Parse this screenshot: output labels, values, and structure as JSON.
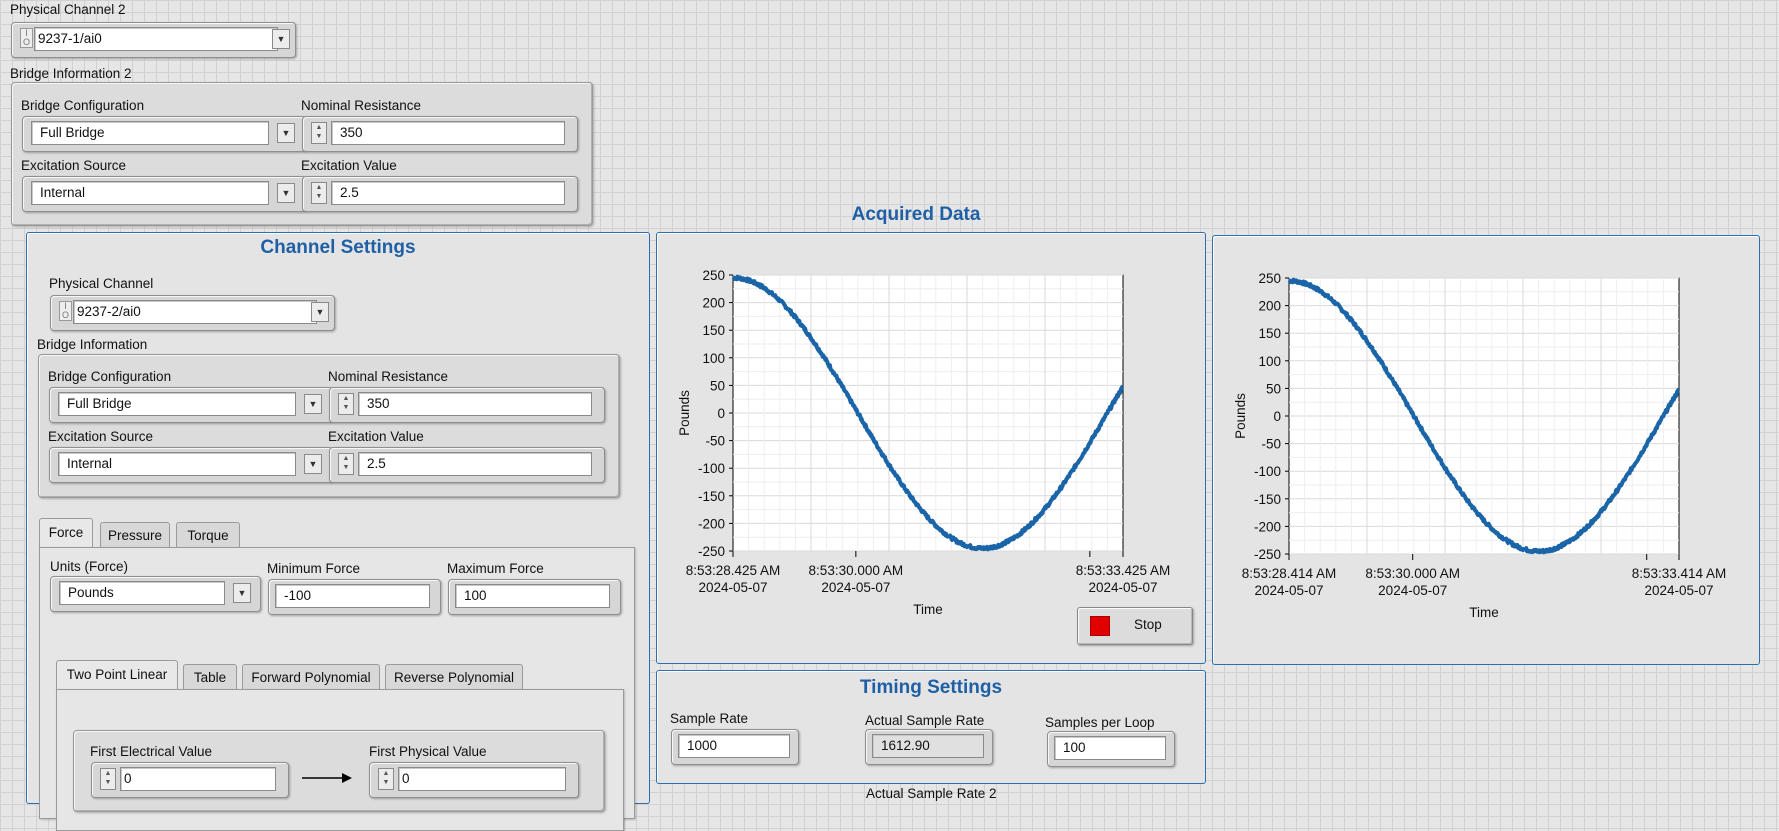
{
  "physical_channel_2": {
    "label": "Physical Channel 2",
    "value": "9237-1/ai0"
  },
  "bridge_info_2": {
    "label": "Bridge Information 2",
    "bridge_config_label": "Bridge Configuration",
    "bridge_config_value": "Full Bridge",
    "nominal_resistance_label": "Nominal Resistance",
    "nominal_resistance_value": "350",
    "excitation_source_label": "Excitation Source",
    "excitation_source_value": "Internal",
    "excitation_value_label": "Excitation Value",
    "excitation_value_value": "2.5"
  },
  "channel_settings": {
    "title": "Channel Settings",
    "physical_channel_label": "Physical Channel",
    "physical_channel_value": "9237-2/ai0",
    "bridge_info_label": "Bridge Information",
    "bridge_config_label": "Bridge Configuration",
    "bridge_config_value": "Full Bridge",
    "nominal_resistance_label": "Nominal Resistance",
    "nominal_resistance_value": "350",
    "excitation_source_label": "Excitation Source",
    "excitation_source_value": "Internal",
    "excitation_value_label": "Excitation Value",
    "excitation_value_value": "2.5",
    "tabs": [
      "Force",
      "Pressure",
      "Torque"
    ],
    "units_label": "Units (Force)",
    "units_value": "Pounds",
    "min_force_label": "Minimum Force",
    "min_force_value": "-100",
    "max_force_label": "Maximum Force",
    "max_force_value": "100",
    "scale_tabs": [
      "Two Point Linear",
      "Table",
      "Forward Polynomial",
      "Reverse Polynomial"
    ],
    "first_electrical_label": "First Electrical Value",
    "first_electrical_value": "0",
    "first_physical_label": "First Physical Value",
    "first_physical_value": "0"
  },
  "acquired_data": {
    "title": "Acquired Data",
    "stop_label": "Stop",
    "stop_color": "#e00000"
  },
  "timing": {
    "title": "Timing Settings",
    "sample_rate_label": "Sample Rate",
    "sample_rate_value": "1000",
    "actual_rate_label": "Actual Sample Rate",
    "actual_rate_value": "1612.90",
    "samples_per_loop_label": "Samples per Loop",
    "samples_per_loop_value": "100",
    "actual_rate_2_label": "Actual Sample Rate 2"
  },
  "chart_data": [
    {
      "type": "line",
      "xlabel": "Time",
      "ylabel": "Pounds",
      "ylim": [
        -250,
        250
      ],
      "yticks": [
        "250",
        "200",
        "150",
        "100",
        "50",
        "0",
        "-50",
        "-100",
        "-150",
        "-200",
        "-250"
      ],
      "xtick_labels": [
        {
          "time": "8:53:28.425 AM",
          "date": "2024-05-07"
        },
        {
          "time": "8:53:30.000 AM",
          "date": "2024-05-07"
        },
        {
          "time": "8:53:33.425 AM",
          "date": "2024-05-07"
        }
      ],
      "x_start_s": 28.425,
      "x_end_s": 33.425,
      "series": [
        {
          "amplitude": 245,
          "period_s": 6.4,
          "phase_start_s": 28.425,
          "color": "#1a64a8"
        }
      ]
    },
    {
      "type": "line",
      "xlabel": "Time",
      "ylabel": "Pounds",
      "ylim": [
        -250,
        250
      ],
      "yticks": [
        "250",
        "200",
        "150",
        "100",
        "50",
        "0",
        "-50",
        "-100",
        "-150",
        "-200",
        "-250"
      ],
      "xtick_labels": [
        {
          "time": "8:53:28.414 AM",
          "date": "2024-05-07"
        },
        {
          "time": "8:53:30.000 AM",
          "date": "2024-05-07"
        },
        {
          "time": "8:53:33.414 AM",
          "date": "2024-05-07"
        }
      ],
      "x_start_s": 28.414,
      "x_end_s": 33.414,
      "series": [
        {
          "amplitude": 245,
          "period_s": 6.4,
          "phase_start_s": 28.414,
          "color": "#1a64a8"
        }
      ]
    }
  ]
}
